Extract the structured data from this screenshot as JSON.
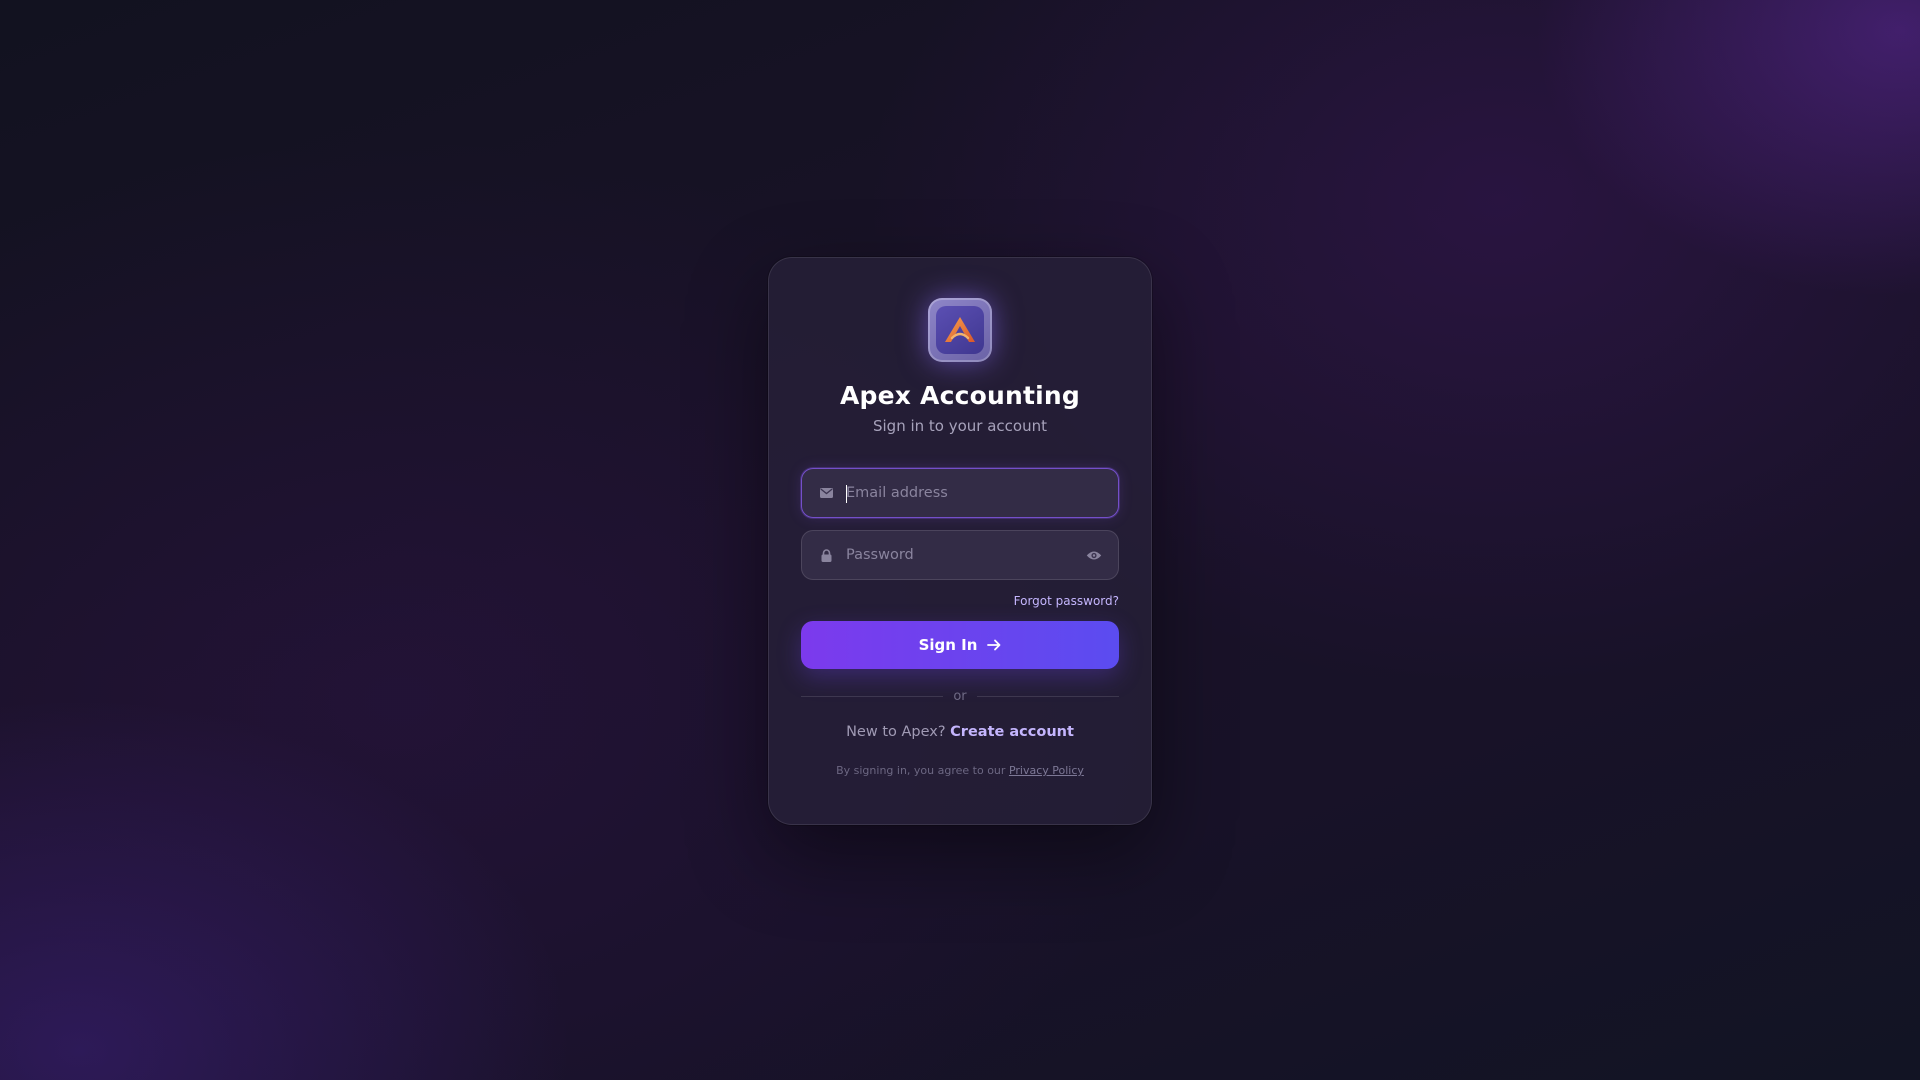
{
  "brand": {
    "logo_icon": "apex-logo-icon",
    "name": "Apex Accounting",
    "subtitle": "Sign in to your account"
  },
  "form": {
    "email": {
      "icon": "mail-icon",
      "placeholder": "Email address",
      "value": ""
    },
    "password": {
      "icon": "lock-icon",
      "placeholder": "Password",
      "value": "",
      "toggle_icon": "eye-icon"
    },
    "forgot_label": "Forgot password?",
    "submit_label": "Sign In",
    "submit_icon": "arrow-right-icon"
  },
  "divider_label": "or",
  "signup": {
    "prompt": "New to Apex?",
    "link_label": "Create account"
  },
  "legal": {
    "text": "By signing in, you agree to our",
    "link_label": "Privacy Policy"
  },
  "colors": {
    "accent": "#8b5cf6",
    "button_start": "#7c3aed",
    "button_end": "#5b4cf0",
    "link": "#c4b5fd"
  }
}
